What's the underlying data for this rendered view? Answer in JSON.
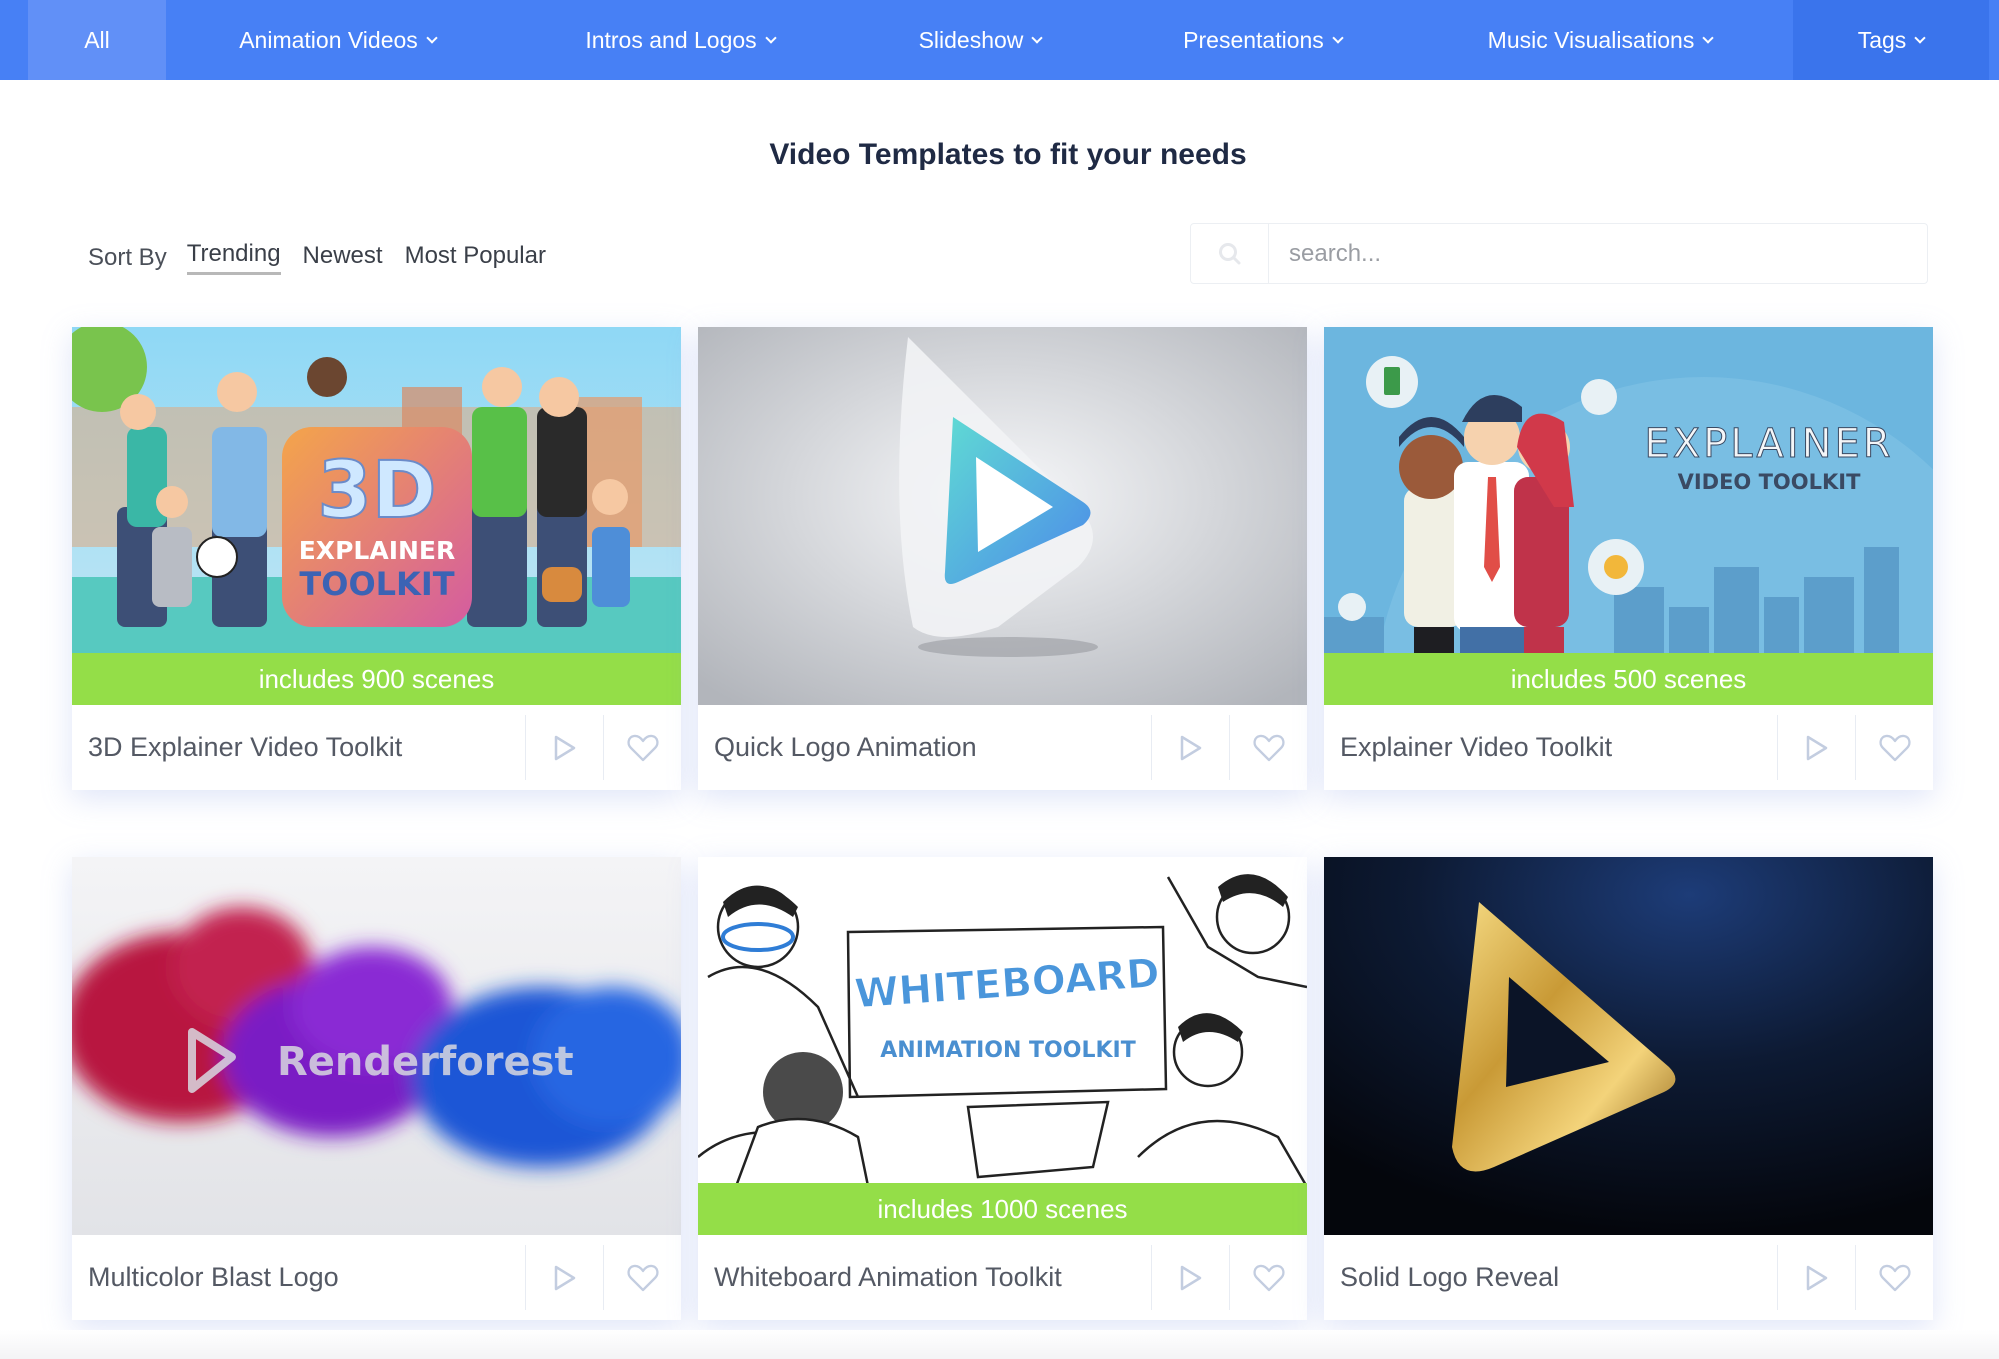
{
  "nav": {
    "items": [
      {
        "label": "All",
        "active": true,
        "dropdown": false
      },
      {
        "label": "Animation Videos",
        "dropdown": true
      },
      {
        "label": "Intros and Logos",
        "dropdown": true
      },
      {
        "label": "Slideshow",
        "dropdown": true
      },
      {
        "label": "Presentations",
        "dropdown": true
      },
      {
        "label": "Music Visualisations",
        "dropdown": true
      },
      {
        "label": "Tags",
        "dropdown": true
      }
    ],
    "colors": {
      "bar": "#4780f5",
      "active": "#6190f7",
      "tags": "#3a74ec"
    }
  },
  "main": {
    "title": "Video Templates to fit your needs",
    "sort": {
      "label": "Sort By",
      "options": [
        "Trending",
        "Newest",
        "Most Popular"
      ],
      "selected": "Trending"
    },
    "search": {
      "placeholder": "search...",
      "value": "",
      "icon": "search-icon"
    }
  },
  "cards": [
    {
      "title": "3D Explainer Video Toolkit",
      "badge": "includes 900 scenes",
      "thumb_text": [
        "3D",
        "EXPLAINER",
        "TOOLKIT"
      ]
    },
    {
      "title": "Quick Logo Animation",
      "badge": null,
      "thumb_text": []
    },
    {
      "title": "Explainer Video Toolkit",
      "badge": "includes 500 scenes",
      "thumb_text": [
        "EXPLAINER",
        "VIDEO TOOLKIT"
      ]
    },
    {
      "title": "Multicolor Blast Logo",
      "badge": null,
      "thumb_text": [
        "Renderforest"
      ]
    },
    {
      "title": "Whiteboard Animation Toolkit",
      "badge": "includes 1000 scenes",
      "thumb_text": [
        "WHITEBOARD",
        "ANIMATION TOOLKIT"
      ]
    },
    {
      "title": "Solid Logo Reveal",
      "badge": null,
      "thumb_text": []
    }
  ],
  "card_actions": {
    "play_icon": "play-icon",
    "like_icon": "heart-icon"
  },
  "colors": {
    "badge": "#94de48",
    "title": "#1f2a44",
    "card_text": "#545964",
    "icon": "#c3cde0"
  }
}
